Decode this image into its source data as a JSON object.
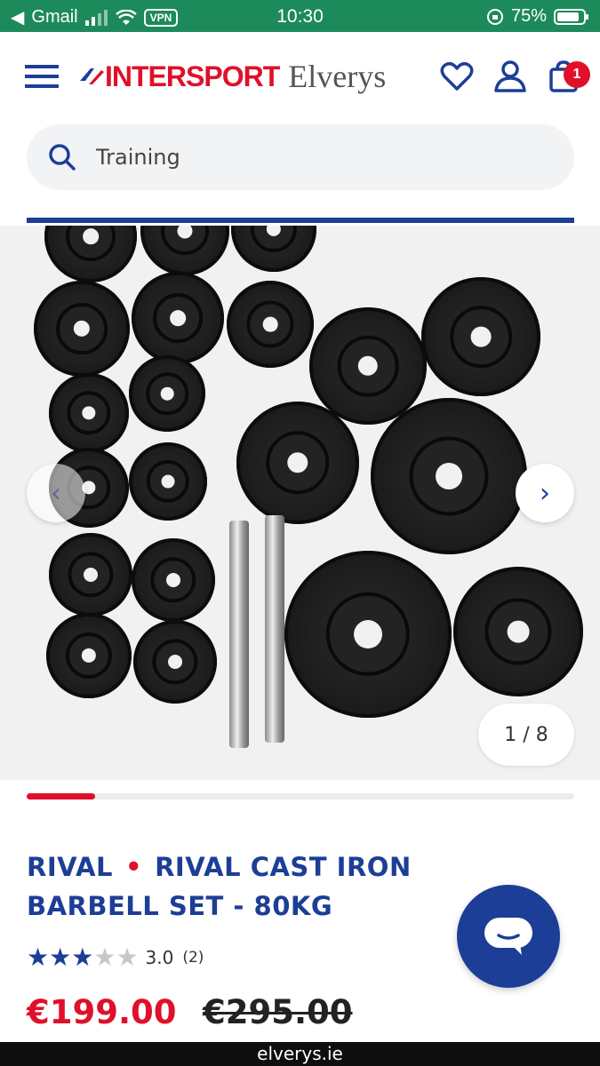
{
  "status_bar": {
    "carrier": "Gmail",
    "vpn": "VPN",
    "time": "10:30",
    "battery": "75%"
  },
  "header": {
    "logo_brand": "INTERSPORT",
    "logo_sub": "Elverys",
    "cart_count": "1",
    "icons": [
      "menu-icon",
      "heart-icon",
      "user-icon",
      "bag-icon"
    ]
  },
  "search": {
    "value": "Training"
  },
  "gallery": {
    "counter": "1 / 8",
    "prev_label": "‹",
    "next_label": "›",
    "current_image": 1,
    "total_images": 8,
    "progress": 0.125
  },
  "product": {
    "brand": "RIVAL",
    "separator": "•",
    "name": "RIVAL CAST IRON BARBELL SET - 80KG",
    "rating_value": "3.0",
    "rating_count": "(2)",
    "rating_stars": 3,
    "rating_max": 5,
    "price": "€199.00",
    "old_price": "€295.00"
  },
  "url": "elverys.ie",
  "colors": {
    "brand_blue": "#1d3e97",
    "brand_red": "#e0102a",
    "status_green": "#1d8a5b"
  }
}
